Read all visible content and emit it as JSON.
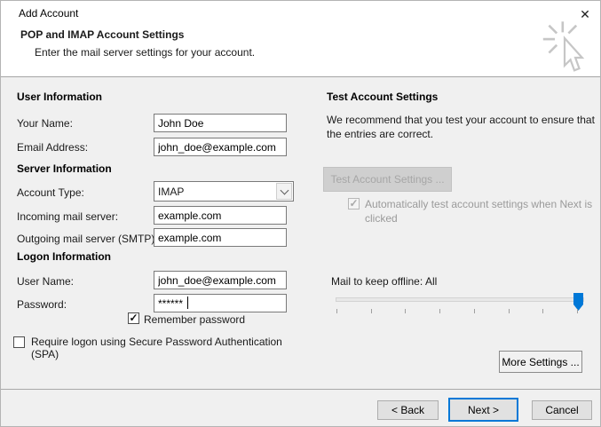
{
  "window": {
    "title": "Add Account",
    "close_glyph": "✕"
  },
  "header": {
    "title": "POP and IMAP Account Settings",
    "subtitle": "Enter the mail server settings for your account."
  },
  "left": {
    "user_section": "User Information",
    "your_name": {
      "label": "Your Name:",
      "value": "John Doe"
    },
    "email_address": {
      "label": "Email Address:",
      "value": "john_doe@example.com"
    },
    "server_section": "Server Information",
    "account_type": {
      "label": "Account Type:",
      "value": "IMAP"
    },
    "incoming_server": {
      "label": "Incoming mail server:",
      "value": "example.com"
    },
    "outgoing_server": {
      "label": "Outgoing mail server (SMTP):",
      "value": "example.com"
    },
    "logon_section": "Logon Information",
    "user_name": {
      "label": "User Name:",
      "value": "john_doe@example.com"
    },
    "password": {
      "label": "Password:",
      "value": "******"
    },
    "remember_password": {
      "label": "Remember password",
      "checked": true,
      "glyph": "✓"
    },
    "spa": {
      "label": "Require logon using Secure Password Authentication (SPA)",
      "checked": false,
      "glyph": ""
    }
  },
  "right": {
    "test_section": "Test Account Settings",
    "test_description": "We recommend that you test your account to ensure that the entries are correct.",
    "test_button": "Test Account Settings ...",
    "auto_test": {
      "label": "Automatically test account settings when Next is clicked",
      "checked": true,
      "disabled": true,
      "glyph": "✓"
    },
    "offline": {
      "label": "Mail to keep offline:",
      "value": "All"
    },
    "more_settings_button": "More Settings ..."
  },
  "footer": {
    "back_button": "< Back",
    "next_button": "Next >",
    "cancel_button": "Cancel"
  },
  "colors": {
    "accent": "#0078d7",
    "body_bg": "#f0f0f0",
    "header_bg": "#ffffff",
    "disabled_text": "#a6a6a6"
  }
}
